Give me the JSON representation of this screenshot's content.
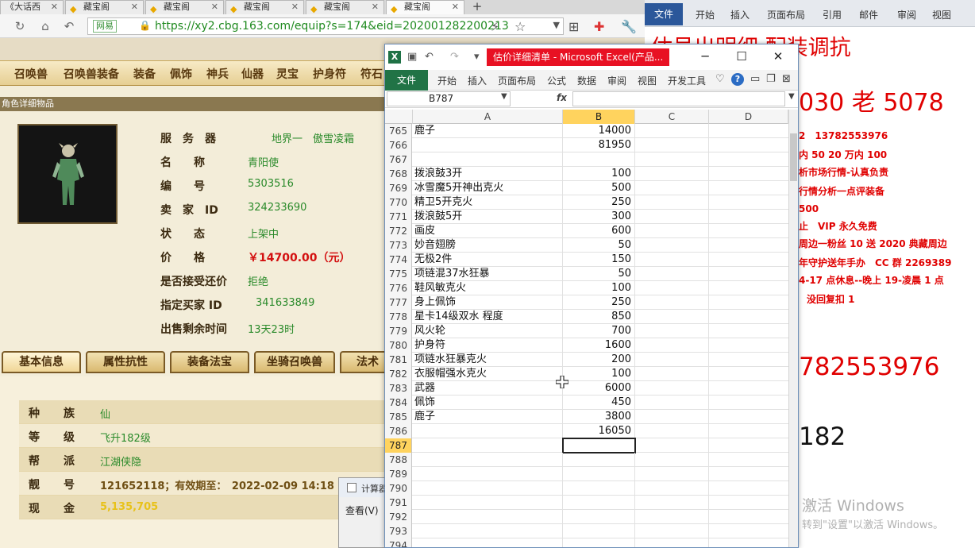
{
  "browser": {
    "tabs": [
      {
        "label": "《大话西"
      },
      {
        "label": "藏宝阁"
      },
      {
        "label": "藏宝阁"
      },
      {
        "label": "藏宝阁"
      },
      {
        "label": "藏宝阁"
      },
      {
        "label": "藏宝阁"
      }
    ],
    "new_tab": "+",
    "site_badge": "网易",
    "url": "https://xy2.cbg.163.com/equip?s=174&eid=202001282200213"
  },
  "categories": [
    "召唤兽",
    "召唤兽装备",
    "装备",
    "佩饰",
    "神兵",
    "仙器",
    "灵宝",
    "护身符",
    "符石"
  ],
  "item_panel": {
    "title": "角色详细物品",
    "fields": [
      {
        "label": "服　务　器",
        "value": "地界一　傲雪凌霜"
      },
      {
        "label": "名　　称",
        "value": "青阳使"
      },
      {
        "label": "编　　号",
        "value": "5303516"
      },
      {
        "label": "卖　家　ID",
        "value": "324233690"
      },
      {
        "label": "状　　态",
        "value": "上架中"
      },
      {
        "label": "价　　格",
        "value": "￥14700.00（元）"
      },
      {
        "label": "是否接受还价",
        "value": "拒绝"
      },
      {
        "label": "指定买家 ID",
        "value": "341633849"
      },
      {
        "label": "出售剩余时间",
        "value": "13天23时"
      }
    ]
  },
  "info_tabs": [
    "基本信息",
    "属性抗性",
    "装备法宝",
    "坐骑召唤兽",
    "法术"
  ],
  "attributes": [
    {
      "k1": "种",
      "k2": "族",
      "v": "仙"
    },
    {
      "k1": "等",
      "k2": "级",
      "v": "飞升182级"
    },
    {
      "k1": "帮",
      "k2": "派",
      "v": "江湖侠隐"
    },
    {
      "k1": "靓",
      "k2": "号",
      "v": "121652118；有效期至：　2022-02-09 14:18"
    },
    {
      "k1": "现",
      "k2": "金",
      "v": "5,135,705"
    }
  ],
  "calc": {
    "title": "计算器",
    "menu": "查看(V)"
  },
  "word": {
    "ribbon": {
      "file": "文件",
      "tabs": [
        "开始",
        "插入",
        "页面布局",
        "引用",
        "邮件",
        "审阅",
        "视图"
      ]
    },
    "lines": [
      {
        "text": "估号出明细 配装调抗",
        "style": "big"
      },
      {
        "text": "030 老 5078",
        "style": "big"
      },
      {
        "text": "2　13782553976",
        "style": "small"
      },
      {
        "text": "内 50 20 万内 100",
        "style": "small"
      },
      {
        "text": "析市场行情-认真负责",
        "style": "small"
      },
      {
        "text": "行情分析一点评装备",
        "style": "small"
      },
      {
        "text": "500",
        "style": "small"
      },
      {
        "text": "止　VIP 永久免费",
        "style": "small"
      },
      {
        "text": "周边一粉丝 10 送 2020 典藏周边",
        "style": "small"
      },
      {
        "text": "年守护送年手办　CC 群 2269389",
        "style": "small"
      },
      {
        "text": "4-17 点休息--晚上 19-凌晨 1 点",
        "style": "small"
      },
      {
        "text": "没回复扣 1",
        "style": "small"
      },
      {
        "text": "782553976",
        "style": "big"
      },
      {
        "text": "182",
        "style": "black"
      },
      {
        "text": "激活 Windows",
        "style": "gray"
      },
      {
        "text": "转到\"设置\"以激活 Windows。",
        "style": "gray"
      }
    ]
  },
  "excel": {
    "title": "估价详细清单 - Microsoft Excel(产品...",
    "ribbon": {
      "file": "文件",
      "tabs": [
        "开始",
        "插入",
        "页面布局",
        "公式",
        "数据",
        "审阅",
        "视图",
        "开发工具"
      ]
    },
    "name_box": "B787",
    "fx": "fx",
    "columns": [
      "A",
      "B",
      "C",
      "D"
    ],
    "rows": [
      {
        "n": "765",
        "a": "鹿子",
        "b": "14000"
      },
      {
        "n": "766",
        "a": "",
        "b": "81950"
      },
      {
        "n": "767",
        "a": "",
        "b": ""
      },
      {
        "n": "768",
        "a": "拨浪鼓3开",
        "b": "100"
      },
      {
        "n": "769",
        "a": "冰雪魔5开神出克火",
        "b": "500"
      },
      {
        "n": "770",
        "a": "精卫5开克火",
        "b": "250"
      },
      {
        "n": "771",
        "a": "拨浪鼓5开",
        "b": "300"
      },
      {
        "n": "772",
        "a": "画皮",
        "b": "600"
      },
      {
        "n": "773",
        "a": "妙音翅膀",
        "b": "50"
      },
      {
        "n": "774",
        "a": "无极2件",
        "b": "150"
      },
      {
        "n": "775",
        "a": "项链混37水狂暴",
        "b": "50"
      },
      {
        "n": "776",
        "a": "鞋风敏克火",
        "b": "100"
      },
      {
        "n": "777",
        "a": "身上佩饰",
        "b": "250"
      },
      {
        "n": "778",
        "a": "星卡14级双水 程度",
        "b": "850"
      },
      {
        "n": "779",
        "a": "风火轮",
        "b": "700"
      },
      {
        "n": "780",
        "a": "护身符",
        "b": "1600"
      },
      {
        "n": "781",
        "a": "项链水狂暴克火",
        "b": "200"
      },
      {
        "n": "782",
        "a": "衣服帽强水克火",
        "b": "100"
      },
      {
        "n": "783",
        "a": "武器",
        "b": "6000"
      },
      {
        "n": "784",
        "a": "佩饰",
        "b": "450"
      },
      {
        "n": "785",
        "a": "鹿子",
        "b": "3800"
      },
      {
        "n": "786",
        "a": "",
        "b": "16050"
      },
      {
        "n": "787",
        "a": "",
        "b": ""
      },
      {
        "n": "788",
        "a": "",
        "b": ""
      },
      {
        "n": "789",
        "a": "",
        "b": ""
      },
      {
        "n": "790",
        "a": "",
        "b": ""
      },
      {
        "n": "791",
        "a": "",
        "b": ""
      },
      {
        "n": "792",
        "a": "",
        "b": ""
      },
      {
        "n": "793",
        "a": "",
        "b": ""
      },
      {
        "n": "794",
        "a": "",
        "b": ""
      }
    ],
    "selected_row": "787"
  }
}
